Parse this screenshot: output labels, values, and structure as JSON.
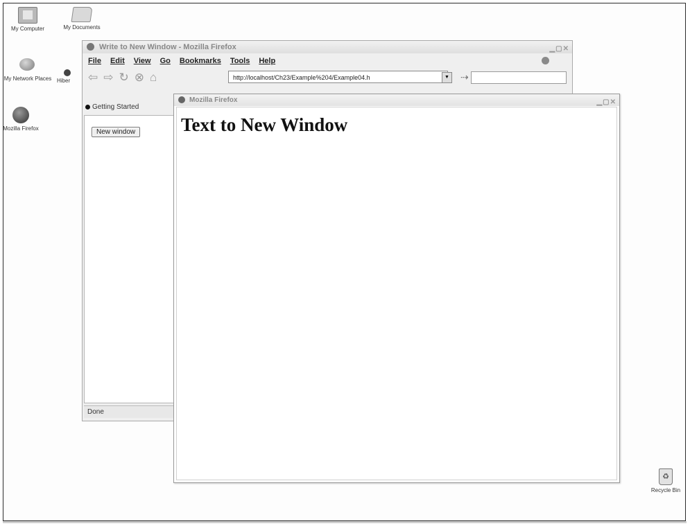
{
  "desktop": {
    "icons": [
      {
        "label": "My Computer",
        "icon": "computer-icon"
      },
      {
        "label": "My Documents",
        "icon": "folder-icon"
      },
      {
        "label": "My Network Places",
        "icon": "network-places-icon"
      },
      {
        "label": "Hiber",
        "icon": "network-folder-icon"
      },
      {
        "label": "Mozilla Firefox",
        "icon": "firefox-icon"
      },
      {
        "label": "Recycle Bin",
        "icon": "recycle-bin-icon"
      }
    ]
  },
  "back_window": {
    "title": "Write to New Window - Mozilla Firefox",
    "menu": [
      "File",
      "Edit",
      "View",
      "Go",
      "Bookmarks",
      "Tools",
      "Help"
    ],
    "url": "http://localhost/Ch23/Example%204/Example04.h",
    "tab_label": "Getting Started",
    "button_label": "New window",
    "status_text": "Done"
  },
  "popup_window": {
    "title": "Mozilla Firefox",
    "heading": "Text to New Window"
  }
}
